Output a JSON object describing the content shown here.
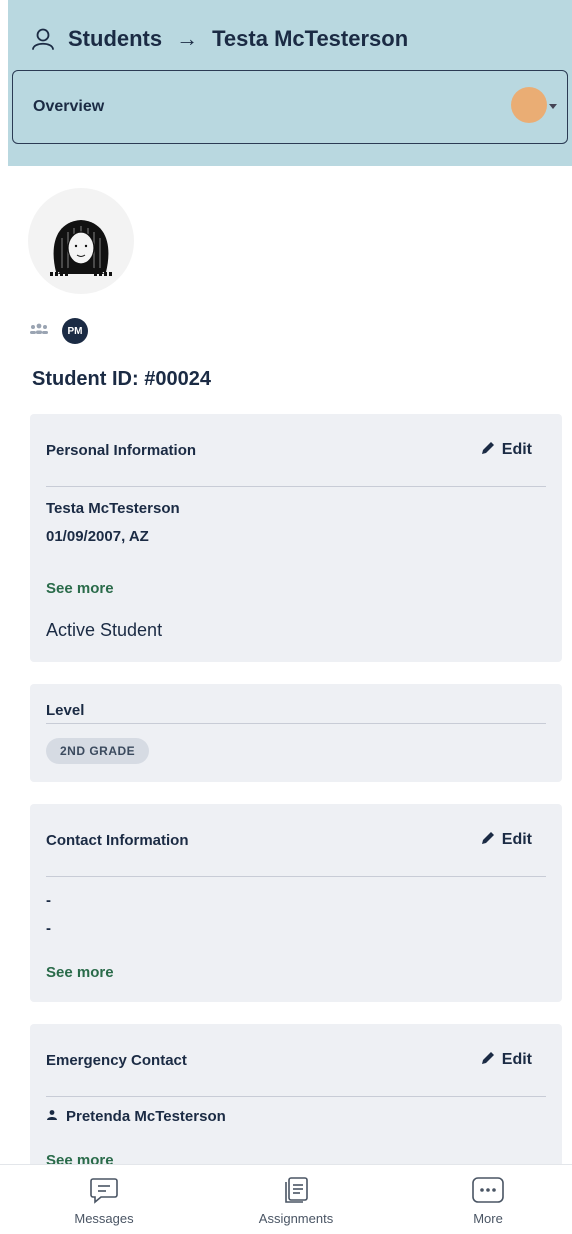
{
  "header": {
    "breadcrumb_root": "Students",
    "breadcrumb_separator": "→",
    "breadcrumb_current": "Testa McTesterson",
    "view_selector_value": "Overview"
  },
  "profile": {
    "pm_badge": "PM",
    "student_id": "Student ID: #00024"
  },
  "personal": {
    "title": "Personal Information",
    "edit_label": "Edit",
    "name": "Testa McTesterson",
    "dob_state": "01/09/2007, AZ",
    "see_more": "See more",
    "status": "Active Student"
  },
  "level": {
    "title": "Level",
    "grade": "2ND GRADE"
  },
  "contact": {
    "title": "Contact Information",
    "edit_label": "Edit",
    "line1": "-",
    "line2": "-",
    "see_more": "See more"
  },
  "emergency": {
    "title": "Emergency Contact",
    "edit_label": "Edit",
    "contact_name": "Pretenda McTesterson",
    "see_more": "See more"
  },
  "nav": {
    "messages": "Messages",
    "assignments": "Assignments",
    "more": "More"
  },
  "colors": {
    "header_bg": "#b9d8e0",
    "card_bg": "#eef0f4",
    "navy": "#1b2b44",
    "link_green": "#2a6b4a",
    "touch_indicator": "#f0a868"
  },
  "icons": [
    "person-outline-icon",
    "group-icon",
    "pencil-icon",
    "person-icon",
    "chat-icon",
    "document-list-icon",
    "ellipsis-icon"
  ]
}
